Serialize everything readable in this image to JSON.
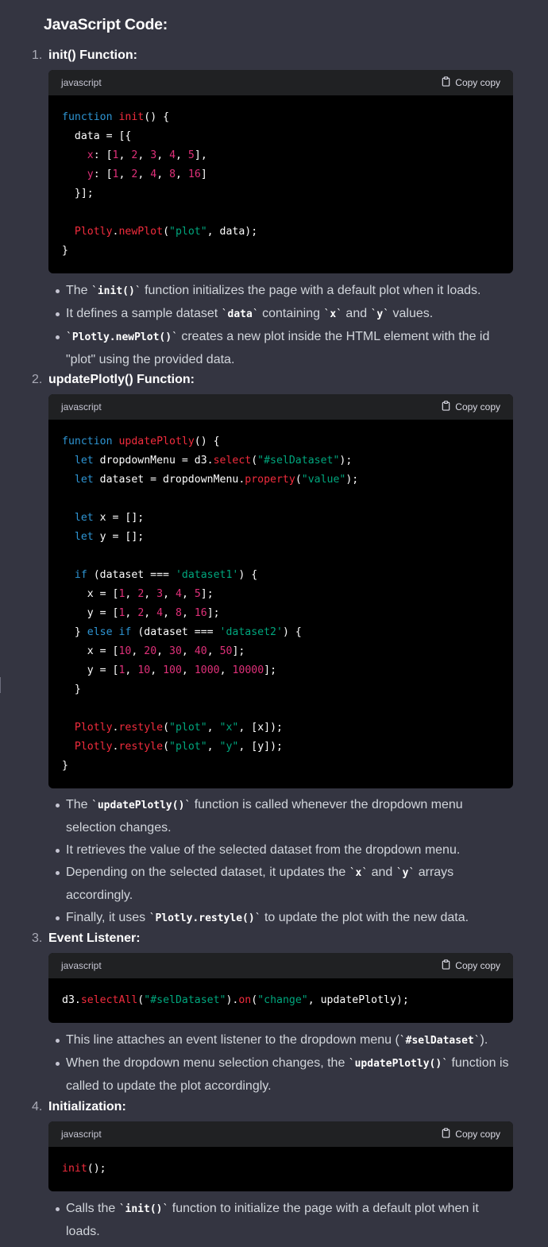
{
  "title": "JavaScript Code:",
  "copy_label": "Copy copy",
  "steps": [
    {
      "num": "1.",
      "label": "init() Function:",
      "lang": "javascript",
      "bullets": [
        {
          "pre": "The ",
          "code": "init()",
          "post": " function initializes the page with a default plot when it loads."
        },
        {
          "pre": "It defines a sample dataset ",
          "code": "data",
          "mid": " containing ",
          "code2": "x",
          "mid2": " and ",
          "code3": "y",
          "post": " values."
        },
        {
          "pre": "",
          "code": "Plotly.newPlot()",
          "post": " creates a new plot inside the HTML element with the id \"plot\" using the provided data."
        }
      ]
    },
    {
      "num": "2.",
      "label": "updatePlotly() Function:",
      "lang": "javascript",
      "bullets": [
        {
          "pre": "The ",
          "code": "updatePlotly()",
          "post": " function is called whenever the dropdown menu selection changes."
        },
        {
          "pre": "It retrieves the value of the selected dataset from the dropdown menu.",
          "code": "",
          "post": ""
        },
        {
          "pre": "Depending on the selected dataset, it updates the ",
          "code": "x",
          "mid": " and ",
          "code2": "y",
          "post": " arrays accordingly."
        },
        {
          "pre": "Finally, it uses ",
          "code": "Plotly.restyle()",
          "post": " to update the plot with the new data."
        }
      ]
    },
    {
      "num": "3.",
      "label": "Event Listener:",
      "lang": "javascript",
      "bullets": [
        {
          "pre": "This line attaches an event listener to the dropdown menu (",
          "code": "#selDataset",
          "post": ")."
        },
        {
          "pre": "When the dropdown menu selection changes, the ",
          "code": "updatePlotly()",
          "post": " function is called to update the plot accordingly."
        }
      ]
    },
    {
      "num": "4.",
      "label": "Initialization:",
      "lang": "javascript",
      "bullets": [
        {
          "pre": "Calls the ",
          "code": "init()",
          "post": " function to initialize the page with a default plot when it loads."
        }
      ]
    }
  ],
  "code": {
    "block1": "function init() {\n  data = [{\n    x: [1, 2, 3, 4, 5],\n    y: [1, 2, 4, 8, 16]\n  }];\n\n  Plotly.newPlot(\"plot\", data);\n}",
    "block2": "function updatePlotly() {\n  let dropdownMenu = d3.select(\"#selDataset\");\n  let dataset = dropdownMenu.property(\"value\");\n\n  let x = [];\n  let y = [];\n\n  if (dataset === 'dataset1') {\n    x = [1, 2, 3, 4, 5];\n    y = [1, 2, 4, 8, 16];\n  } else if (dataset === 'dataset2') {\n    x = [10, 20, 30, 40, 50];\n    y = [1, 10, 100, 1000, 10000];\n  }\n\n  Plotly.restyle(\"plot\", \"x\", [x]);\n  Plotly.restyle(\"plot\", \"y\", [y]);\n}",
    "block3": "d3.selectAll(\"#selDataset\").on(\"change\", updatePlotly);",
    "block4": "init();"
  },
  "colors": {
    "background": "#343541",
    "code_bg": "#000000",
    "code_header": "#202123",
    "keyword": "#2e95d3",
    "function": "#f22c3d",
    "number": "#df3079",
    "string": "#00a67d"
  }
}
